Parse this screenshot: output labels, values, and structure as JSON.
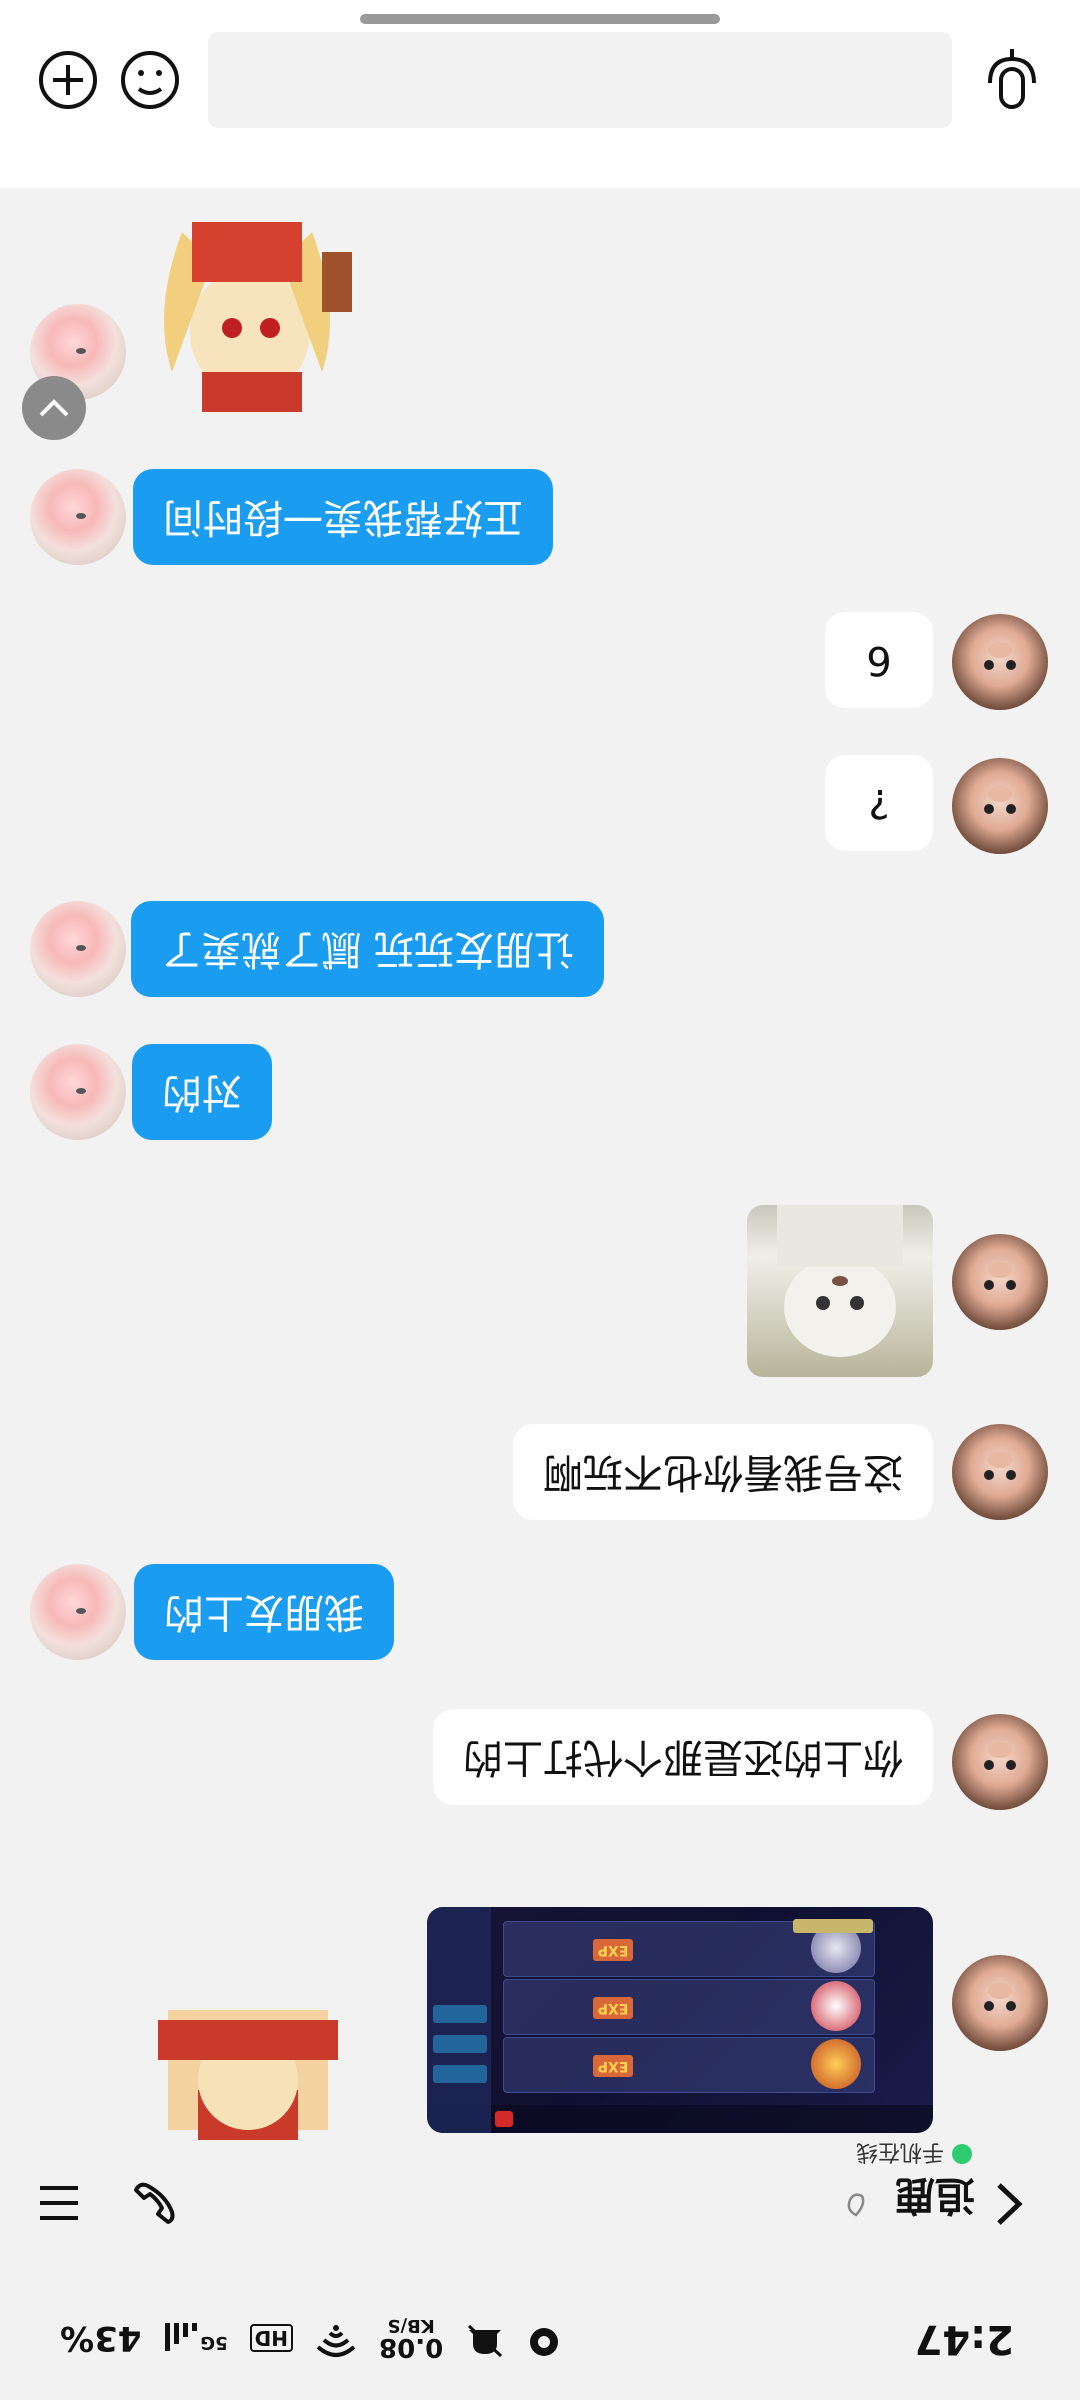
{
  "status_bar": {
    "time": "2:47",
    "net_speed_value": "0.08",
    "net_speed_unit": "KB/S",
    "hd": "HD",
    "signal": "5G",
    "battery": "43%"
  },
  "header": {
    "contact_name": "追鹿",
    "presence": "手机在线",
    "presence_color": "#2ecc71"
  },
  "messages": [
    {
      "side": "other",
      "type": "sticker"
    },
    {
      "side": "other",
      "type": "text",
      "text": "正好帮我卖一段时间"
    },
    {
      "side": "mine",
      "type": "text",
      "text": "6"
    },
    {
      "side": "mine",
      "type": "text",
      "text": "?"
    },
    {
      "side": "other",
      "type": "text",
      "text": "让朋友玩玩 腻了就卖了"
    },
    {
      "side": "other",
      "type": "text",
      "text": "对的"
    },
    {
      "side": "mine",
      "type": "image"
    },
    {
      "side": "mine",
      "type": "text",
      "text": "这号我看你也不玩啊"
    },
    {
      "side": "other",
      "type": "text",
      "text": "我朋友上的"
    },
    {
      "side": "mine",
      "type": "text",
      "text": "你上的还是那个代打上的"
    },
    {
      "side": "mine",
      "type": "image",
      "desc": "game screenshot"
    },
    {
      "side": "other",
      "type": "sticker"
    }
  ],
  "colors": {
    "bubble_mine": "#ffffff",
    "bubble_other": "#1a9cf0",
    "background": "#f2f2f2"
  },
  "icons": [
    "back-chevron-icon",
    "phone-icon",
    "menu-icon",
    "mic-icon",
    "emoji-icon",
    "plus-icon",
    "scroll-up-icon"
  ]
}
